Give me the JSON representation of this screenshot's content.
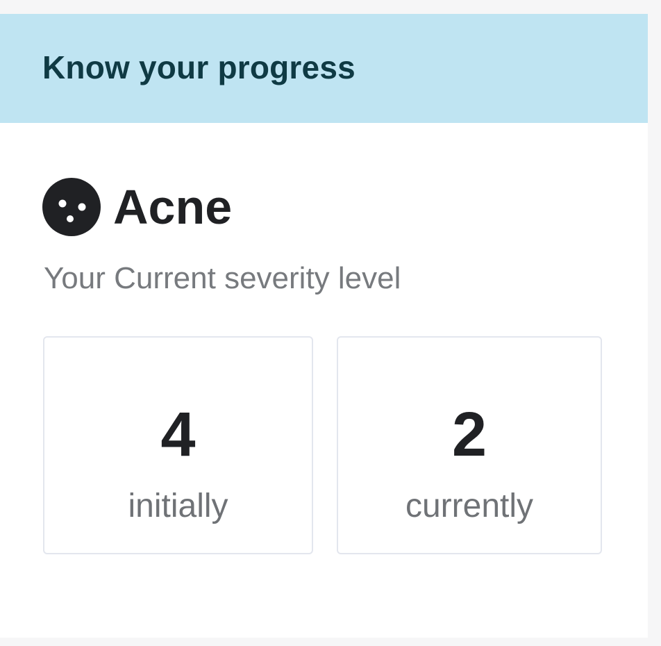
{
  "header": {
    "title": "Know your progress"
  },
  "condition": {
    "icon": "acne-icon",
    "name": "Acne",
    "severity_label": "Your Current severity level"
  },
  "severity": {
    "initial": {
      "value": "4",
      "caption": "initially"
    },
    "current": {
      "value": "2",
      "caption": "currently"
    }
  },
  "colors": {
    "banner_bg": "#bfe4f2",
    "banner_text": "#0f3a44",
    "primary_text": "#202124",
    "secondary_text": "#777a7e"
  }
}
